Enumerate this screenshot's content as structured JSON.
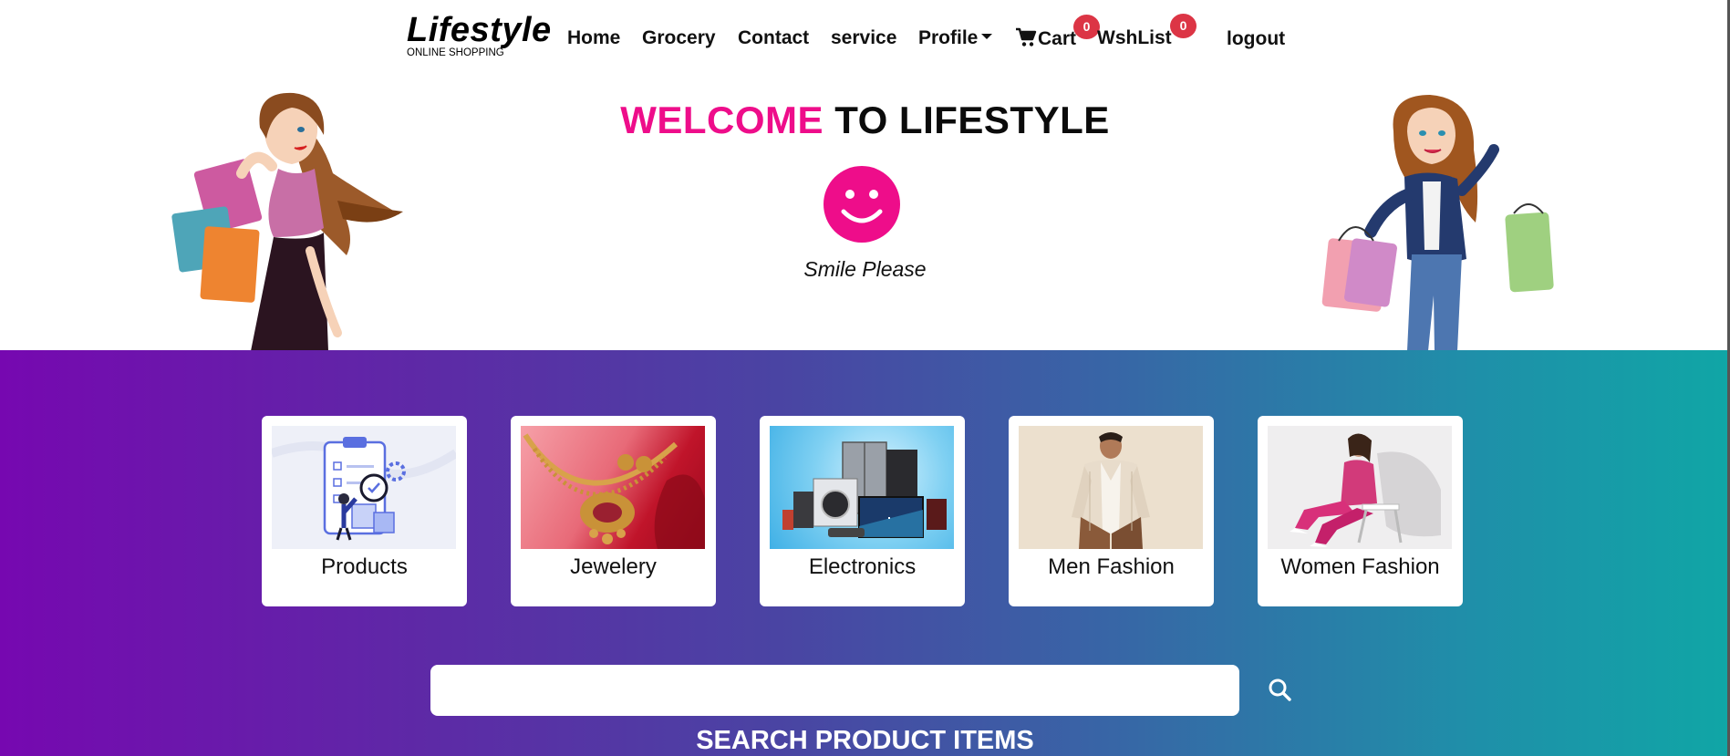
{
  "brand": {
    "title": "Lifestyle",
    "subtitle": "ONLINE SHOPPING"
  },
  "nav": {
    "home": "Home",
    "grocery": "Grocery",
    "contact": "Contact",
    "service": "service",
    "profile": "Profile",
    "cart": "Cart",
    "cart_count": "0",
    "wishlist": "WshList",
    "wishlist_count": "0",
    "logout": "logout"
  },
  "hero": {
    "title_highlight": "WELCOME",
    "title_rest": "TO LIFESTYLE",
    "smile_text": "Smile Please"
  },
  "categories": [
    {
      "label": "Products",
      "icon": "clipboard-checklist-illustration"
    },
    {
      "label": "Jewelery",
      "icon": "gold-necklace-photo"
    },
    {
      "label": "Electronics",
      "icon": "appliances-photo"
    },
    {
      "label": "Men Fashion",
      "icon": "man-shirt-photo"
    },
    {
      "label": "Women Fashion",
      "icon": "woman-pink-suit-photo"
    }
  ],
  "search": {
    "value": "",
    "placeholder": "",
    "title": "SEARCH PRODUCT ITEMS"
  },
  "colors": {
    "accent_pink": "#ee0d8a",
    "badge_red": "#dc3545",
    "gradient_start": "#7608b0",
    "gradient_end": "#10a6a6"
  }
}
